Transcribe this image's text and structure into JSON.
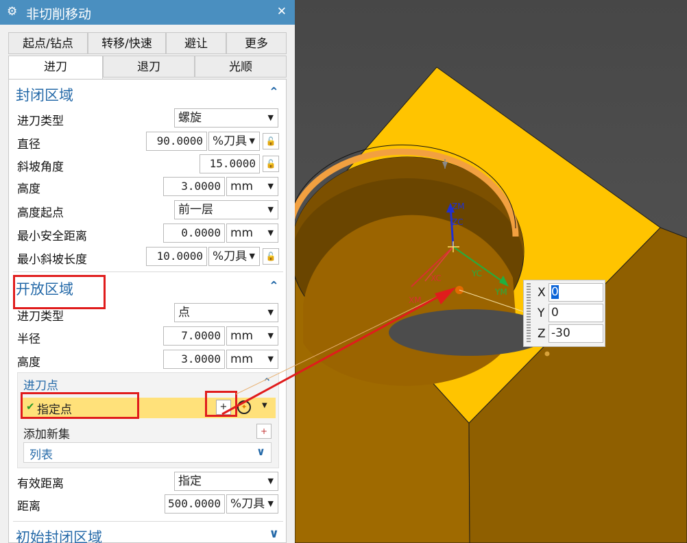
{
  "dialog": {
    "title": "非切削移动",
    "close_label": "✕"
  },
  "tabs_row1": [
    "起点/钻点",
    "转移/快速",
    "避让",
    "更多"
  ],
  "tabs_row2": [
    "进刀",
    "退刀",
    "光顺"
  ],
  "closed_region": {
    "title": "封闭区域",
    "entry_type_label": "进刀类型",
    "entry_type_value": "螺旋",
    "diameter_label": "直径",
    "diameter_value": "90.0000",
    "diameter_unit": "%刀具",
    "ramp_angle_label": "斜坡角度",
    "ramp_angle_value": "15.0000",
    "height_label": "高度",
    "height_value": "3.0000",
    "height_unit": "mm",
    "height_from_label": "高度起点",
    "height_from_value": "前一层",
    "min_clearance_label": "最小安全距离",
    "min_clearance_value": "0.0000",
    "min_clearance_unit": "mm",
    "min_ramp_label": "最小斜坡长度",
    "min_ramp_value": "10.0000",
    "min_ramp_unit": "%刀具"
  },
  "open_region": {
    "title": "开放区域",
    "entry_type_label": "进刀类型",
    "entry_type_value": "点",
    "radius_label": "半径",
    "radius_value": "7.0000",
    "radius_unit": "mm",
    "height_label": "高度",
    "height_value": "3.0000",
    "height_unit": "mm"
  },
  "entry_point": {
    "title": "进刀点",
    "specify_point_label": "指定点",
    "add_set_label": "添加新集",
    "list_label": "列表"
  },
  "valid_distance": {
    "label": "有效距离",
    "value": "指定",
    "distance_label": "距离",
    "distance_value": "500.0000",
    "distance_unit": "%刀具"
  },
  "initial_closed_region": {
    "title": "初始封闭区域"
  },
  "viewport": {
    "axes": {
      "zm": "ZM",
      "zc": "ZC",
      "xc": "XC",
      "xm": "XM",
      "yc": "YC",
      "ym": "YM"
    },
    "coords": {
      "x_label": "X",
      "x_value": "0",
      "y_label": "Y",
      "y_value": "0",
      "z_label": "Z",
      "z_value": "-30"
    }
  },
  "colors": {
    "block_top": "#ffc400",
    "block_side": "#9f6a00",
    "hole_wall": "#9b6400",
    "annotation": "#e01c1c",
    "title_bar": "#4a8fc0"
  },
  "icons": [
    "gear-icon",
    "close-icon",
    "lock-icon",
    "chevron-up-icon",
    "chevron-down-icon",
    "point-dialog-icon",
    "point-type-icon",
    "add-set-icon",
    "check-icon"
  ]
}
